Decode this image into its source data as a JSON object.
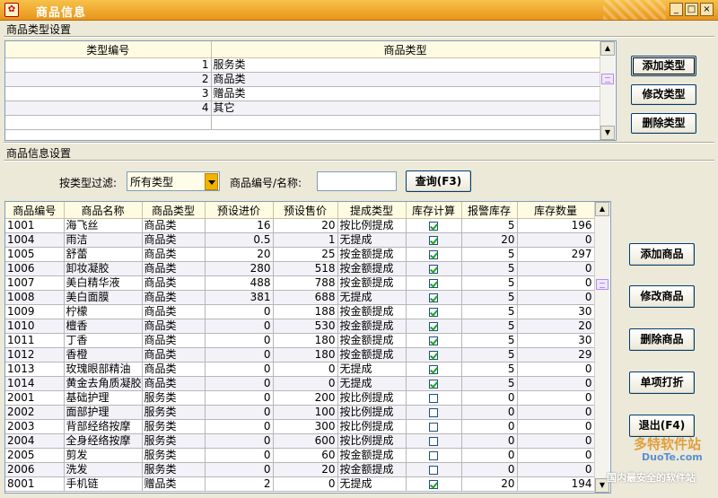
{
  "window": {
    "title": "商品信息",
    "min": "_",
    "max": "□",
    "close": "×"
  },
  "type_section": {
    "label": "商品类型设置",
    "headers": [
      "类型编号",
      "商品类型"
    ],
    "rows": [
      {
        "id": "1",
        "name": "服务类"
      },
      {
        "id": "2",
        "name": "商品类"
      },
      {
        "id": "3",
        "name": "赠品类"
      },
      {
        "id": "4",
        "name": "其它"
      }
    ],
    "buttons": {
      "add": "添加类型",
      "edit": "修改类型",
      "delete": "删除类型"
    }
  },
  "goods_section": {
    "label": "商品信息设置",
    "filter_label": "按类型过滤:",
    "filter_value": "所有类型",
    "search_label": "商品编号/名称:",
    "search_value": "",
    "query_button": "查询(F3)",
    "headers": [
      "商品编号",
      "商品名称",
      "商品类型",
      "预设进价",
      "预设售价",
      "提成类型",
      "库存计算",
      "报警库存",
      "库存数量"
    ],
    "rows": [
      {
        "code": "1001",
        "name": "海飞丝",
        "type": "商品类",
        "cost": "16",
        "price": "20",
        "commission": "按比例提成",
        "stock_calc": true,
        "alarm": "5",
        "qty": "196"
      },
      {
        "code": "1004",
        "name": "雨洁",
        "type": "商品类",
        "cost": "0.5",
        "price": "1",
        "commission": "无提成",
        "stock_calc": true,
        "alarm": "20",
        "qty": "0"
      },
      {
        "code": "1005",
        "name": "舒蕾",
        "type": "商品类",
        "cost": "20",
        "price": "25",
        "commission": "按金额提成",
        "stock_calc": true,
        "alarm": "5",
        "qty": "297"
      },
      {
        "code": "1006",
        "name": "卸妆凝胶",
        "type": "商品类",
        "cost": "280",
        "price": "518",
        "commission": "按金额提成",
        "stock_calc": true,
        "alarm": "5",
        "qty": "0"
      },
      {
        "code": "1007",
        "name": "美白精华液",
        "type": "商品类",
        "cost": "488",
        "price": "788",
        "commission": "按金额提成",
        "stock_calc": true,
        "alarm": "5",
        "qty": "0"
      },
      {
        "code": "1008",
        "name": "美白面膜",
        "type": "商品类",
        "cost": "381",
        "price": "688",
        "commission": "无提成",
        "stock_calc": true,
        "alarm": "5",
        "qty": "0"
      },
      {
        "code": "1009",
        "name": "柠檬",
        "type": "商品类",
        "cost": "0",
        "price": "188",
        "commission": "按金额提成",
        "stock_calc": true,
        "alarm": "5",
        "qty": "30"
      },
      {
        "code": "1010",
        "name": "檀香",
        "type": "商品类",
        "cost": "0",
        "price": "530",
        "commission": "按金额提成",
        "stock_calc": true,
        "alarm": "5",
        "qty": "20"
      },
      {
        "code": "1011",
        "name": "丁香",
        "type": "商品类",
        "cost": "0",
        "price": "180",
        "commission": "按金额提成",
        "stock_calc": true,
        "alarm": "5",
        "qty": "30"
      },
      {
        "code": "1012",
        "name": "香橙",
        "type": "商品类",
        "cost": "0",
        "price": "180",
        "commission": "按金额提成",
        "stock_calc": true,
        "alarm": "5",
        "qty": "29"
      },
      {
        "code": "1013",
        "name": "玫瑰眼部精油",
        "type": "商品类",
        "cost": "0",
        "price": "0",
        "commission": "无提成",
        "stock_calc": true,
        "alarm": "5",
        "qty": "0"
      },
      {
        "code": "1014",
        "name": "黄金去角质凝胶",
        "type": "商品类",
        "cost": "0",
        "price": "0",
        "commission": "无提成",
        "stock_calc": true,
        "alarm": "5",
        "qty": "0"
      },
      {
        "code": "2001",
        "name": "基础护理",
        "type": "服务类",
        "cost": "0",
        "price": "200",
        "commission": "按比例提成",
        "stock_calc": false,
        "alarm": "0",
        "qty": "0"
      },
      {
        "code": "2002",
        "name": "面部护理",
        "type": "服务类",
        "cost": "0",
        "price": "100",
        "commission": "按比例提成",
        "stock_calc": false,
        "alarm": "0",
        "qty": "0"
      },
      {
        "code": "2003",
        "name": "背部经络按摩",
        "type": "服务类",
        "cost": "0",
        "price": "300",
        "commission": "按比例提成",
        "stock_calc": false,
        "alarm": "0",
        "qty": "0"
      },
      {
        "code": "2004",
        "name": "全身经络按摩",
        "type": "服务类",
        "cost": "0",
        "price": "600",
        "commission": "按比例提成",
        "stock_calc": false,
        "alarm": "0",
        "qty": "0"
      },
      {
        "code": "2005",
        "name": "剪发",
        "type": "服务类",
        "cost": "0",
        "price": "60",
        "commission": "按金额提成",
        "stock_calc": false,
        "alarm": "0",
        "qty": "0"
      },
      {
        "code": "2006",
        "name": "洗发",
        "type": "服务类",
        "cost": "0",
        "price": "20",
        "commission": "按金额提成",
        "stock_calc": false,
        "alarm": "0",
        "qty": "0"
      },
      {
        "code": "8001",
        "name": "手机链",
        "type": "赠品类",
        "cost": "2",
        "price": "0",
        "commission": "无提成",
        "stock_calc": true,
        "alarm": "20",
        "qty": "194"
      }
    ],
    "buttons": {
      "add": "添加商品",
      "edit": "修改商品",
      "delete": "删除商品",
      "print": "单项打折",
      "exit": "退出(F4)"
    }
  },
  "watermark": {
    "brand": "多特软件站",
    "domain": "DuoTe.com",
    "slogan": "国内最安全的软件站"
  }
}
